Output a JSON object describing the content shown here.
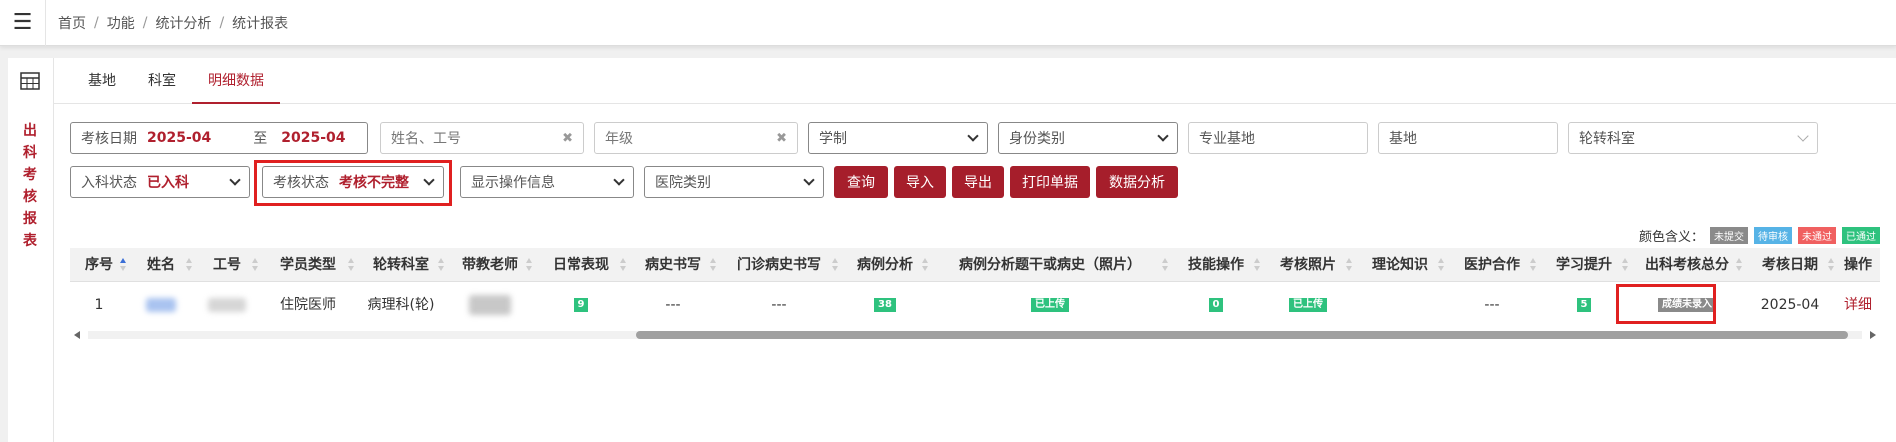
{
  "breadcrumb": [
    "首页",
    "功能",
    "统计分析",
    "统计报表"
  ],
  "sidebar": {
    "title": "出科考核报表"
  },
  "tabs": [
    {
      "label": "基地",
      "active": false
    },
    {
      "label": "科室",
      "active": false
    },
    {
      "label": "明细数据",
      "active": true
    }
  ],
  "filters": {
    "date_label": "考核日期",
    "date_from": "2025-04",
    "date_to_label": "至",
    "date_to": "2025-04",
    "name_placeholder": "姓名、工号",
    "grade_placeholder": "年级",
    "xuezhi": "学制",
    "identity": "身份类别",
    "major_base_placeholder": "专业基地",
    "base_placeholder": "基地",
    "rotation_dept": "轮转科室",
    "enter_label": "入科状态",
    "enter_value": "已入科",
    "assess_label": "考核状态",
    "assess_value": "考核不完整",
    "show_ops": "显示操作信息",
    "hospital_type": "医院类别"
  },
  "buttons": {
    "query": "查询",
    "import": "导入",
    "export": "导出",
    "print": "打印单据",
    "analysis": "数据分析"
  },
  "legend": {
    "label": "颜色含义：",
    "items": [
      {
        "text": "未提交",
        "color": "#8a8a8a"
      },
      {
        "text": "待审核",
        "color": "#56b3e6"
      },
      {
        "text": "未通过",
        "color": "#f06060"
      },
      {
        "text": "已通过",
        "color": "#2ec27e"
      }
    ]
  },
  "table": {
    "headers": [
      "序号",
      "姓名",
      "工号",
      "学员类型",
      "轮转科室",
      "带教老师",
      "日常表现",
      "病史书写",
      "门诊病史书写",
      "病例分析",
      "病例分析题干或病史（照片）",
      "技能操作",
      "考核照片",
      "理论知识",
      "医护合作",
      "学习提升",
      "出科考核总分",
      "考核日期",
      "操作"
    ],
    "row": {
      "index": "1",
      "student_type": "住院医师",
      "rotation": "病理科(轮)",
      "daily": "9",
      "history": "---",
      "clinic_history": "---",
      "case_analysis": "38",
      "case_photo": "已上传",
      "skill": "0",
      "exam_photo": "已上传",
      "theory": "",
      "nurse_coop": "---",
      "learning": "5",
      "total": "成绩未录入",
      "exam_date": "2025-04",
      "action": "详细"
    }
  }
}
